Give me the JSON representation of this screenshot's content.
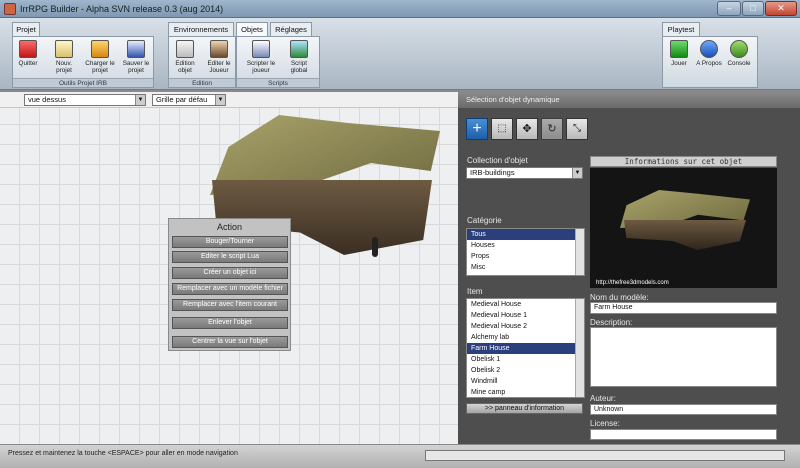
{
  "window": {
    "title": "IrrRPG Builder - Alpha SVN release 0.3 (aug 2014)"
  },
  "ribbon": {
    "tabs": [
      {
        "label": "Projet"
      },
      {
        "label": "Environnements"
      },
      {
        "label": "Objets"
      },
      {
        "label": "Réglages"
      },
      {
        "label": "Playtest"
      }
    ],
    "groups": {
      "projet": {
        "caption": "Outils Projet IRB",
        "buttons": [
          {
            "label": "Quitter"
          },
          {
            "label": "Nouv. projet"
          },
          {
            "label": "Charger le projet"
          },
          {
            "label": "Sauver le projet"
          }
        ]
      },
      "edition": {
        "caption": "Edition",
        "buttons": [
          {
            "label": "Edition objet"
          },
          {
            "label": "Editer le Joueur"
          }
        ]
      },
      "scripts": {
        "caption": "Scripts",
        "buttons": [
          {
            "label": "Scripter le joueur"
          },
          {
            "label": "Script global"
          }
        ]
      },
      "playtest": {
        "buttons": [
          {
            "label": "Jouer"
          },
          {
            "label": "A Propos"
          },
          {
            "label": "Console"
          }
        ]
      }
    }
  },
  "viewport": {
    "view_select": "vue dessus",
    "grid_select": "Grille par défau"
  },
  "action_panel": {
    "title": "Action",
    "buttons": [
      {
        "label": "Bouger/Tourner"
      },
      {
        "label": "Editer le script Lua"
      },
      {
        "label": "Créer un objet ici"
      },
      {
        "label": "Remplacer avec un modèle fichier"
      },
      {
        "label": "Remplacer avec l'item courant"
      },
      {
        "label": "Enlever l'objet"
      },
      {
        "label": "Centrer la vue sur l'objet"
      }
    ]
  },
  "right_panel": {
    "header": "Sélection d'objet dynamique",
    "collection_label": "Collection d'objet",
    "collection_value": "IRB-buildings",
    "category_label": "Catégorie",
    "categories": [
      "Tous",
      "Houses",
      "Props",
      "Misc"
    ],
    "item_label": "Item",
    "items": [
      "Medieval House",
      "Medieval House 1",
      "Medieval House 2",
      "Alchemy lab",
      "Farm House",
      "Obelisk 1",
      "Obelisk 2",
      "Windmill",
      "Mine camp"
    ],
    "info_title": "Informations sur cet objet",
    "preview_credit": "http://thefree3dmodels.com",
    "model_name_label": "Nom du modèle:",
    "model_name": "Farm House",
    "description_label": "Description:",
    "author_label": "Auteur:",
    "author": "Unknown",
    "license_label": "License:",
    "info_panel_button": ">> panneau d'information"
  },
  "statusbar": {
    "text": "Pressez et maintenez la touche <ESPACE> pour aller en mode navigation"
  },
  "colors": {
    "selection": "#2b3f7c",
    "tool_active": "#1d5ea8",
    "panel_bg": "#4e4e4e"
  }
}
